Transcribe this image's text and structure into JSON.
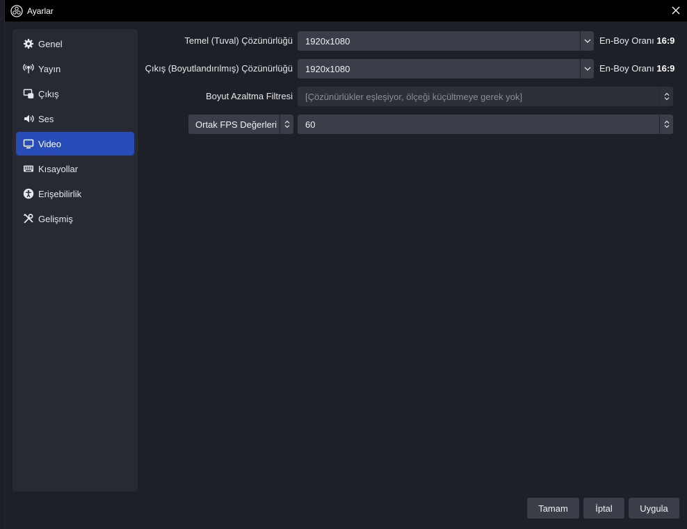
{
  "window": {
    "title": "Ayarlar"
  },
  "sidebar": {
    "items": [
      {
        "label": "Genel",
        "icon": "gear-icon"
      },
      {
        "label": "Yayın",
        "icon": "antenna-icon"
      },
      {
        "label": "Çıkış",
        "icon": "output-icon"
      },
      {
        "label": "Ses",
        "icon": "speaker-icon"
      },
      {
        "label": "Video",
        "icon": "monitor-icon",
        "active": true
      },
      {
        "label": "Kısayollar",
        "icon": "keyboard-icon"
      },
      {
        "label": "Erişebilirlik",
        "icon": "accessibility-icon"
      },
      {
        "label": "Gelişmiş",
        "icon": "tools-icon"
      }
    ]
  },
  "video": {
    "base_resolution": {
      "label": "Temel (Tuval) Çözünürlüğü",
      "value": "1920x1080",
      "aspect_label": "En-Boy Oranı",
      "aspect_value": "16:9"
    },
    "output_resolution": {
      "label": "Çıkış (Boyutlandırılmış) Çözünürlüğü",
      "value": "1920x1080",
      "aspect_label": "En-Boy Oranı",
      "aspect_value": "16:9"
    },
    "downscale_filter": {
      "label": "Boyut Azaltma Filtresi",
      "value": "[Çözünürlükler eşleşiyor, ölçeği küçültmeye gerek yok]"
    },
    "fps": {
      "type_label": "Ortak FPS Değerleri",
      "value": "60"
    }
  },
  "buttons": {
    "ok": "Tamam",
    "cancel": "İptal",
    "apply": "Uygula"
  },
  "colors": {
    "accent": "#284cb8",
    "panel": "#272a33",
    "background": "#1e2028",
    "input": "#3b3e48"
  }
}
